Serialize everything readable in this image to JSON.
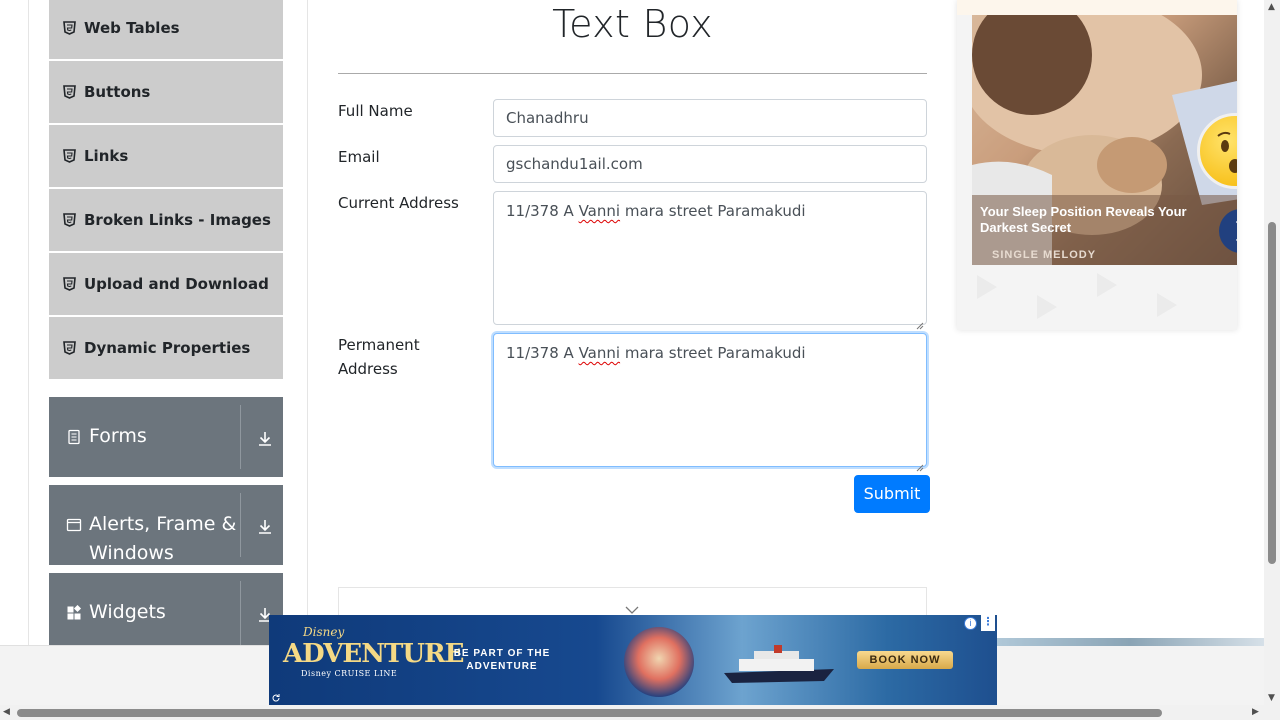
{
  "sidebar": {
    "sub_items": [
      {
        "label": "Web Tables"
      },
      {
        "label": "Buttons"
      },
      {
        "label": "Links"
      },
      {
        "label": "Broken Links - Images"
      },
      {
        "label": "Upload and Download"
      },
      {
        "label": "Dynamic Properties"
      }
    ],
    "groups": [
      {
        "label": "Forms",
        "icon": "document-icon"
      },
      {
        "label_line1": "Alerts, Frame &",
        "label_line2": "Windows",
        "icon": "window-icon"
      },
      {
        "label": "Widgets",
        "icon": "widgets-icon"
      }
    ]
  },
  "main": {
    "title": "Text Box",
    "fields": {
      "full_name": {
        "label": "Full Name",
        "value": "Chanadhru"
      },
      "email": {
        "label": "Email",
        "value": "gschandu1ail.com"
      },
      "current_address": {
        "label": "Current Address",
        "value_pre": "11/378 A ",
        "value_squiggle": "Vanni",
        "value_post": " mara street Paramakudi"
      },
      "permanent_address": {
        "label_line1": "Permanent",
        "label_line2": "Address",
        "value_pre": "11/378 A ",
        "value_squiggle": "Vanni",
        "value_post": " mara street Paramakudi"
      }
    },
    "submit_label": "Submit"
  },
  "ads": {
    "right": {
      "caption": "Your Sleep Position Reveals Your Darkest Secret",
      "brand": "SINGLE MELODY"
    },
    "bottom": {
      "logo_line1": "Disney",
      "logo_line2": "ADVENTURE",
      "logo_line3": "Disney CRUISE LINE",
      "tagline": "BE PART OF THE ADVENTURE",
      "cta": "BOOK NOW",
      "info": "i",
      "menu": "⋮"
    }
  },
  "colors": {
    "primary": "#007bff",
    "sidebar_group": "#6c757d",
    "sidebar_item": "#cccccc"
  }
}
